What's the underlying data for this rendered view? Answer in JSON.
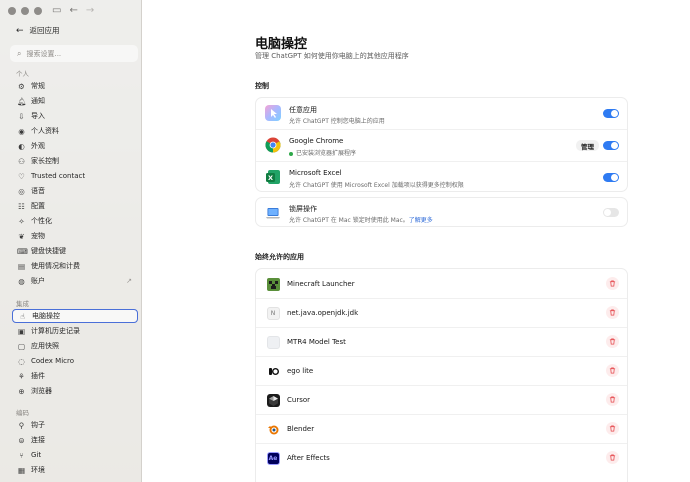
{
  "sidebar": {
    "back_label": "返回应用",
    "search_placeholder": "搜索设置...",
    "section_personal": "个人",
    "section_integrations": "集成",
    "section_coding": "编码",
    "personal_items": [
      {
        "label": "常规",
        "icon": "gear-icon"
      },
      {
        "label": "通知",
        "icon": "bell-icon"
      },
      {
        "label": "导入",
        "icon": "import-icon"
      },
      {
        "label": "个人资料",
        "icon": "person-icon"
      },
      {
        "label": "外观",
        "icon": "appearance-icon"
      },
      {
        "label": "家长控制",
        "icon": "parental-control-icon"
      },
      {
        "label": "Trusted contact",
        "icon": "trusted-contact-icon"
      },
      {
        "label": "语音",
        "icon": "voice-icon"
      },
      {
        "label": "配置",
        "icon": "sliders-icon"
      },
      {
        "label": "个性化",
        "icon": "personalization-icon"
      },
      {
        "label": "宠物",
        "icon": "pet-icon"
      },
      {
        "label": "键盘快捷键",
        "icon": "keyboard-icon"
      },
      {
        "label": "使用情况和计费",
        "icon": "usage-icon"
      },
      {
        "label": "账户",
        "icon": "account-icon"
      }
    ],
    "integration_items": [
      {
        "label": "电脑操控",
        "icon": "computer-control-icon"
      },
      {
        "label": "计算机历史记录",
        "icon": "history-icon"
      },
      {
        "label": "应用快照",
        "icon": "snapshot-icon"
      },
      {
        "label": "Codex Micro",
        "icon": "codex-icon"
      },
      {
        "label": "插件",
        "icon": "plugin-icon"
      },
      {
        "label": "浏览器",
        "icon": "browser-icon"
      }
    ],
    "coding_items": [
      {
        "label": "钩子",
        "icon": "hook-icon"
      },
      {
        "label": "连接",
        "icon": "globe-icon"
      },
      {
        "label": "Git",
        "icon": "git-icon"
      },
      {
        "label": "环境",
        "icon": "environment-icon"
      }
    ],
    "active_item": "电脑操控"
  },
  "main": {
    "title": "电脑操控",
    "subtitle": "管理 ChatGPT 如何使用你电脑上的其他应用程序",
    "control_header": "控制",
    "control_rows": [
      {
        "name": "任意应用",
        "desc": "允许 ChatGPT 控制您电脑上的应用",
        "toggle": true
      },
      {
        "name": "Google Chrome",
        "desc": "已安装浏览器扩展程序",
        "toggle": true,
        "button": "管理"
      },
      {
        "name": "Microsoft Excel",
        "desc": "允许 ChatGPT 使用 Microsoft Excel 加载项以获得更多控制权限",
        "toggle": true
      }
    ],
    "lock_row": {
      "name": "锁屏操作",
      "desc": "允许 ChatGPT 在 Mac 锁定时使用此 Mac。",
      "link": "了解更多",
      "toggle": false
    },
    "allowed_header": "始终允许的应用",
    "allowed_apps": [
      {
        "name": "Minecraft Launcher",
        "icon": "minecraft-icon"
      },
      {
        "name": "net.java.openjdk.jdk",
        "icon": "java-icon"
      },
      {
        "name": "MTR4 Model Test",
        "icon": "mtr4-icon"
      },
      {
        "name": "ego lite",
        "icon": "ego-icon"
      },
      {
        "name": "Cursor",
        "icon": "cursor-icon"
      },
      {
        "name": "Blender",
        "icon": "blender-icon"
      },
      {
        "name": "After Effects",
        "icon": "after-effects-icon"
      }
    ]
  },
  "colors": {
    "accent": "#2f7bf2",
    "danger": "#e5484d",
    "active_border": "#4a6fd8"
  }
}
